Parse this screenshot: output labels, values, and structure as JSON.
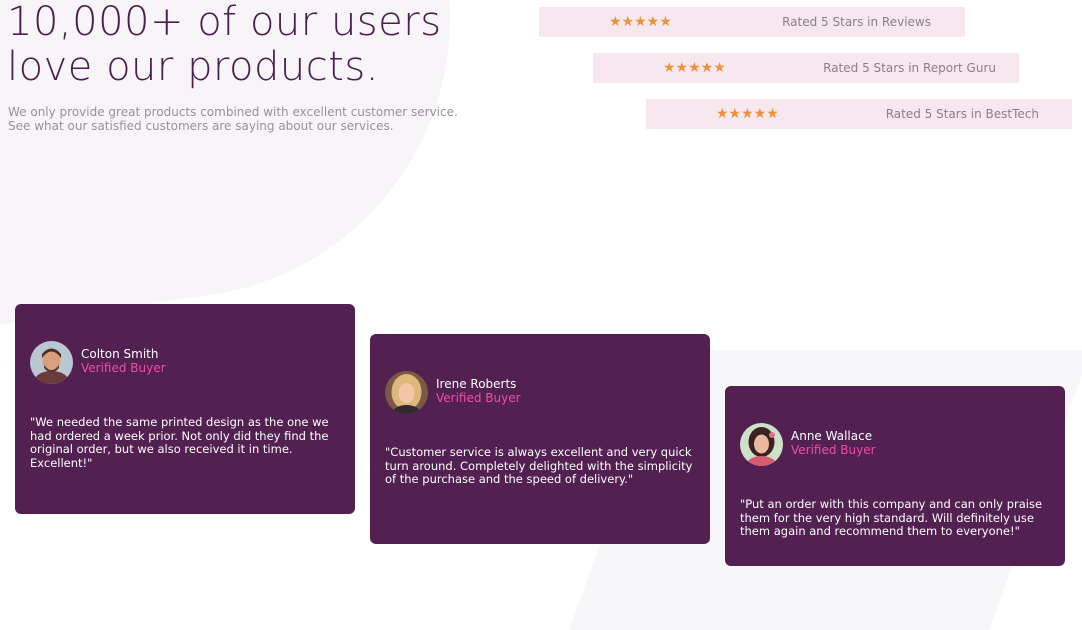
{
  "hero": {
    "title": "10,000+ of our users love our products.",
    "subtitle_line1": "We only provide great products combined with excellent customer service.",
    "subtitle_line2": "See what our satisfied customers are saying about our services."
  },
  "ratings": [
    {
      "stars": "★★★★★",
      "label": "Rated 5 Stars in Reviews"
    },
    {
      "stars": "★★★★★",
      "label": "Rated 5 Stars in Report Guru"
    },
    {
      "stars": "★★★★★",
      "label": "Rated 5 Stars in BestTech"
    }
  ],
  "testimonials": [
    {
      "name": "Colton Smith",
      "badge": "Verified Buyer",
      "quote": "\"We needed the same printed design as the one we had ordered a week prior. Not only did they find the original order, but we also received it in time. Excellent!\""
    },
    {
      "name": "Irene Roberts",
      "badge": "Verified Buyer",
      "quote": "\"Customer service is always excellent and very quick turn around. Completely delighted with the simplicity of the purchase and the speed of delivery.\""
    },
    {
      "name": "Anne Wallace",
      "badge": "Verified Buyer",
      "quote": "\"Put an order with this company and can only praise them for the very high standard. Will definitely use them again and recommend them to everyone!\""
    }
  ],
  "colors": {
    "title": "#4a1e4d",
    "card_bg": "#522051",
    "badge": "#f04fa0",
    "stars": "#f0913a",
    "rating_bg": "#f6e8ee"
  }
}
